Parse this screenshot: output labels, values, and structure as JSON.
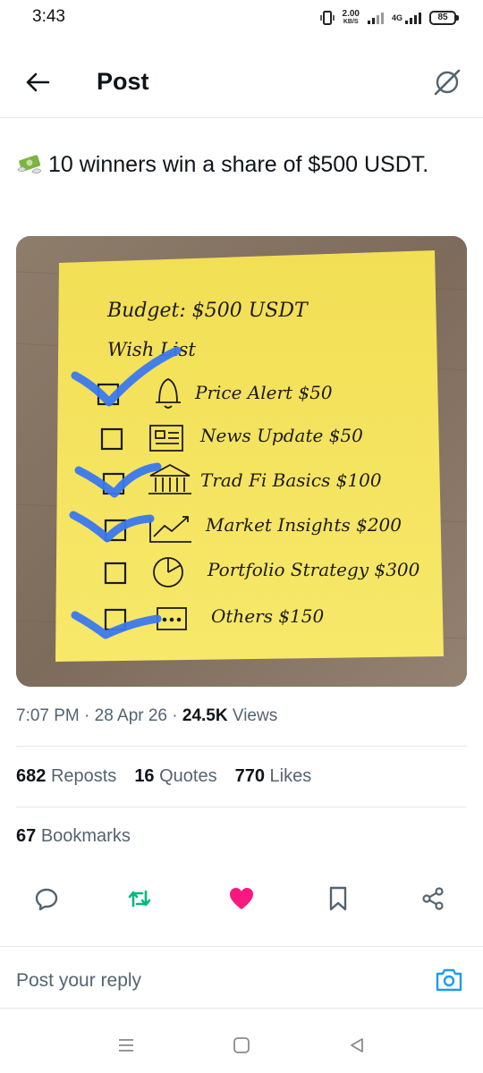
{
  "status_bar": {
    "time": "3:43",
    "net_speed_value": "2.00",
    "net_speed_unit": "KB/S",
    "network_type": "4G",
    "battery": "85"
  },
  "header": {
    "title": "Post"
  },
  "post": {
    "emoji_icon": "money-with-wings-icon",
    "text": "10 winners win a share of $500 USDT.",
    "image_note": {
      "budget": "Budget: $500 USDT",
      "wishlist_title": "Wish List",
      "items": [
        {
          "label": "Price Alert $50",
          "icon": "bell-icon",
          "checked": true
        },
        {
          "label": "News Update $50",
          "icon": "newspaper-icon",
          "checked": false
        },
        {
          "label": "Trad Fi Basics $100",
          "icon": "bank-icon",
          "checked": true
        },
        {
          "label": "Market Insights $200",
          "icon": "chart-trend-icon",
          "checked": true
        },
        {
          "label": "Portfolio Strategy $300",
          "icon": "pie-chart-icon",
          "checked": false
        },
        {
          "label": "Others $150",
          "icon": "ellipsis-box-icon",
          "checked": true
        }
      ]
    },
    "time": "7:07 PM",
    "date": "28 Apr 26",
    "views_count": "24.5K",
    "views_label": "Views"
  },
  "stats": {
    "reposts_count": "682",
    "reposts_label": "Reposts",
    "quotes_count": "16",
    "quotes_label": "Quotes",
    "likes_count": "770",
    "likes_label": "Likes",
    "bookmarks_count": "67",
    "bookmarks_label": "Bookmarks"
  },
  "colors": {
    "repost_active": "#00ba7c",
    "like_active": "#f91880",
    "accent": "#1d9bf0",
    "check_mark": "#3a78f0",
    "note_yellow": "#f5e35a"
  },
  "reply": {
    "placeholder": "Post your reply"
  }
}
